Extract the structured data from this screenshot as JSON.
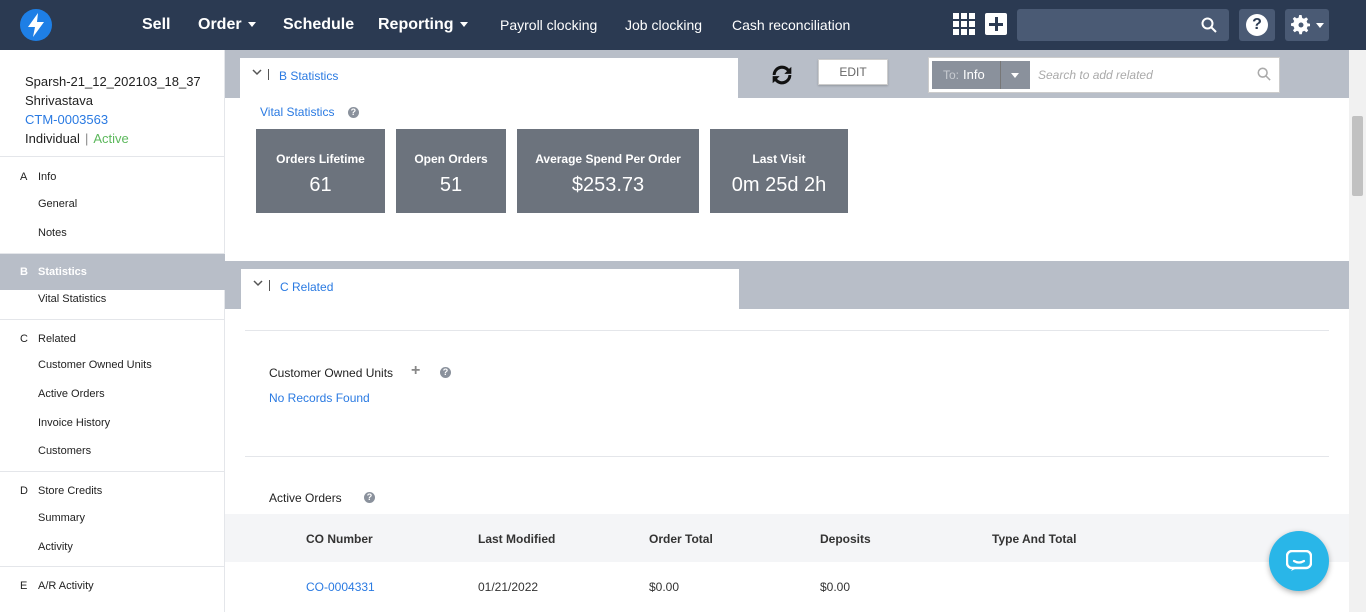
{
  "topnav": {
    "logo_icon": "lightning-bolt-icon",
    "links": [
      {
        "label": "Sell"
      },
      {
        "label": "Order"
      },
      {
        "label": "Schedule"
      },
      {
        "label": "Reporting"
      },
      {
        "label": "Payroll clocking"
      },
      {
        "label": "Job clocking"
      },
      {
        "label": "Cash reconciliation"
      }
    ],
    "search_value": "",
    "help_label": "?"
  },
  "customer": {
    "name": "Sparsh-21_12_202103_18_37 Shrivastava",
    "id": "CTM-0003563",
    "type": "Individual",
    "status": "Active"
  },
  "sidebar": {
    "sections": [
      {
        "letter": "A",
        "label": "Info",
        "items": [
          "General",
          "Notes"
        ]
      },
      {
        "letter": "B",
        "label": "Statistics",
        "items": [
          "Vital Statistics"
        ]
      },
      {
        "letter": "C",
        "label": "Related",
        "items": [
          "Customer Owned Units",
          "Active Orders",
          "Invoice History",
          "Customers"
        ]
      },
      {
        "letter": "D",
        "label": "Store Credits",
        "items": [
          "Summary",
          "Activity"
        ]
      },
      {
        "letter": "E",
        "label": "A/R Activity",
        "items": []
      }
    ]
  },
  "toolbar": {
    "statistics_tab": "B Statistics",
    "edit_label": "EDIT",
    "to_prefix": "To:",
    "to_value": "Info",
    "related_placeholder": "Search to add related"
  },
  "vital": {
    "title": "Vital Statistics",
    "stats": [
      {
        "label": "Orders Lifetime",
        "value": "61"
      },
      {
        "label": "Open Orders",
        "value": "51"
      },
      {
        "label": "Average Spend Per Order",
        "value": "$253.73"
      },
      {
        "label": "Last Visit",
        "value": "0m 25d 2h"
      }
    ]
  },
  "related": {
    "tab": "C Related",
    "owned_units_title": "Customer Owned Units",
    "no_records": "No Records Found",
    "active_orders_title": "Active Orders",
    "columns": [
      "CO Number",
      "Last Modified",
      "Order Total",
      "Deposits",
      "Type And Total"
    ],
    "rows": [
      {
        "co_number": "CO-0004331",
        "last_modified": "01/21/2022",
        "order_total": "$0.00",
        "deposits": "$0.00",
        "type_total": ""
      }
    ]
  },
  "colors": {
    "nav_bg": "#2b3a52",
    "accent": "#2a7ae2",
    "tile_bg": "#6c737d",
    "active": "#5cb85c",
    "chat": "#29b6e8"
  }
}
